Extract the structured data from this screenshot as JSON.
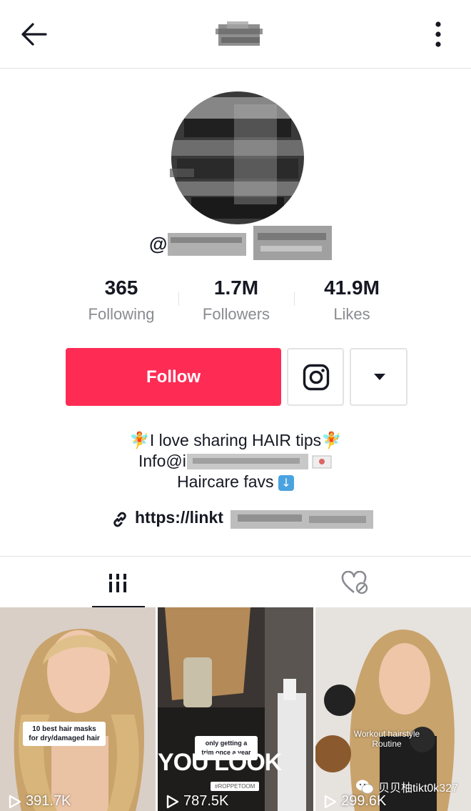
{
  "header": {
    "back_icon": "arrow-left-icon",
    "more_icon": "vertical-dots-icon"
  },
  "profile": {
    "username_prefix": "@"
  },
  "stats": [
    {
      "value": "365",
      "label": "Following"
    },
    {
      "value": "1.7M",
      "label": "Followers"
    },
    {
      "value": "41.9M",
      "label": "Likes"
    }
  ],
  "actions": {
    "follow_label": "Follow",
    "instagram_icon": "instagram-icon",
    "dropdown_icon": "caret-down-icon"
  },
  "bio": {
    "line1": "I love sharing HAIR tips",
    "line1_emoji": "🧚",
    "line2_prefix": "Info@i",
    "line3": "Haircare favs",
    "line3_emoji": "⬇️",
    "link_prefix": "https://linkt"
  },
  "tabs": [
    {
      "name": "videos",
      "icon": "grid-bars-icon",
      "active": true
    },
    {
      "name": "liked",
      "icon": "heart-hidden-icon",
      "active": false
    }
  ],
  "videos": [
    {
      "views": "391.7K",
      "caption": "10 best hair masks for dry/damaged hair"
    },
    {
      "views": "787.5K",
      "caption": "only getting a trim once a year",
      "overlay": "YOU LOOK",
      "overlay_tag": "#ROPPETOOM"
    },
    {
      "views": "299.6K",
      "caption": "Workout hairstyle Routine"
    }
  ],
  "watermark": {
    "text": "贝贝柚tikt0k327"
  },
  "colors": {
    "accent": "#fe2c55",
    "text": "#161823",
    "muted": "#8a8b91",
    "divider": "#e3e3e4"
  }
}
